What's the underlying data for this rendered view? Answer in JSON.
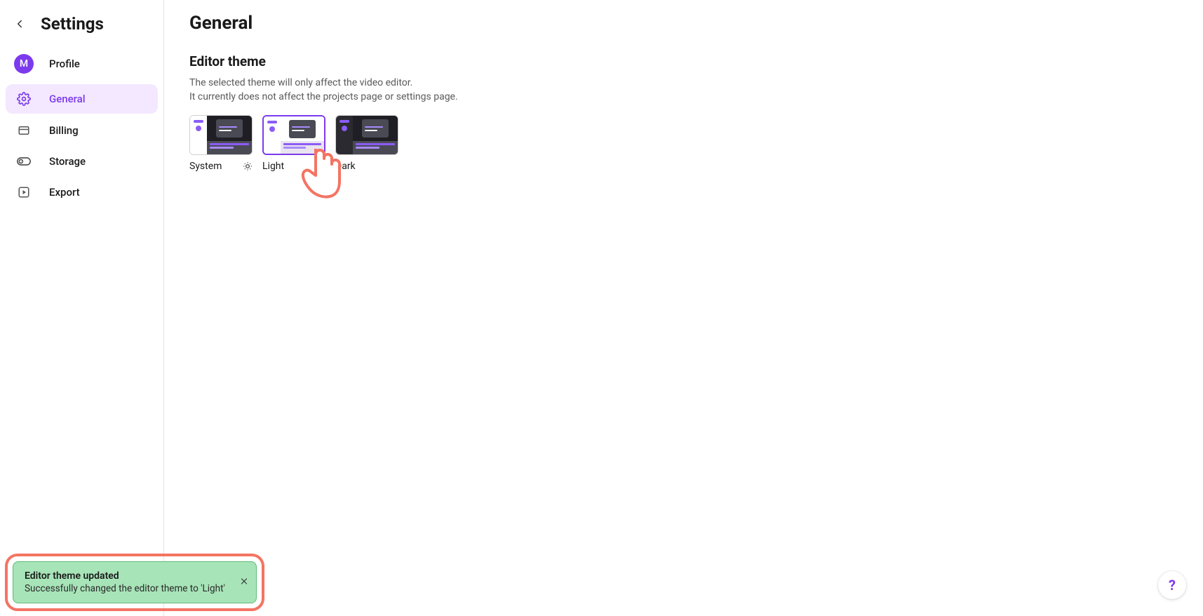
{
  "sidebar": {
    "title": "Settings",
    "avatar_letter": "M",
    "items": [
      {
        "label": "Profile",
        "icon": "avatar"
      },
      {
        "label": "General",
        "icon": "gear",
        "active": true
      },
      {
        "label": "Billing",
        "icon": "card"
      },
      {
        "label": "Storage",
        "icon": "toggle"
      },
      {
        "label": "Export",
        "icon": "play-square"
      }
    ]
  },
  "main": {
    "title": "General",
    "section_title": "Editor theme",
    "section_desc_line1": "The selected theme will only affect the video editor.",
    "section_desc_line2": "It currently does not affect the projects page or settings page.",
    "themes": [
      {
        "label": "System",
        "current": true
      },
      {
        "label": "Light",
        "selected": true
      },
      {
        "label": "Dark"
      }
    ]
  },
  "toast": {
    "title": "Editor theme updated",
    "message": "Successfully changed the editor theme to 'Light'"
  },
  "help": {
    "label": "?"
  }
}
